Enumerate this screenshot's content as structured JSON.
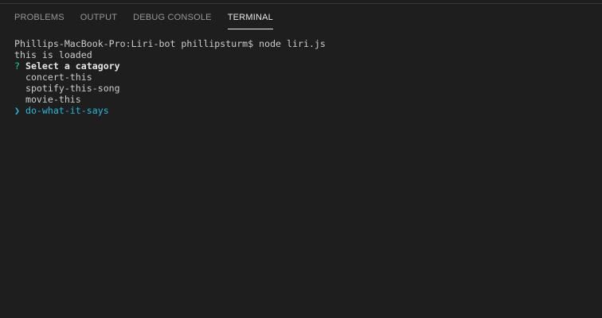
{
  "panel": {
    "tabs": [
      {
        "label": "PROBLEMS"
      },
      {
        "label": "OUTPUT"
      },
      {
        "label": "DEBUG CONSOLE"
      },
      {
        "label": "TERMINAL"
      }
    ],
    "active_tab": "TERMINAL"
  },
  "terminal": {
    "command_line": "Phillips-MacBook-Pro:Liri-bot phillipsturm$ node liri.js",
    "output": "this is loaded",
    "prompt_marker": "?",
    "prompt_question": "Select a catagory",
    "options": [
      "concert-this",
      "spotify-this-song",
      "movie-this"
    ],
    "pointer": "❯",
    "selected_option": "do-what-it-says"
  },
  "colors": {
    "background": "#1e1e1e",
    "prompt": "#23d18b",
    "selected": "#29b8db"
  }
}
